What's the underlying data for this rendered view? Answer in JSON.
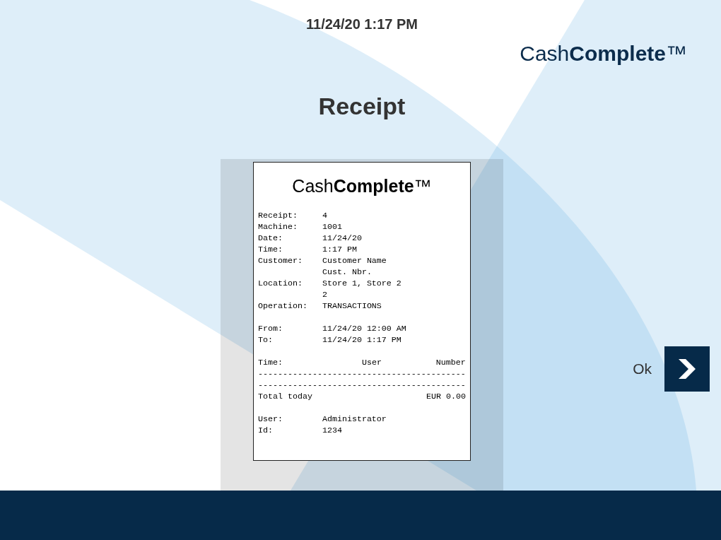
{
  "datetime": "11/24/20 1:17 PM",
  "brand_logo": "Cash**Complete**™",
  "title": "Receipt",
  "receipt": {
    "logo": "Cash**Complete**™",
    "details": [
      {
        "label": "Receipt:",
        "values": [
          "4"
        ]
      },
      {
        "label": "Machine:",
        "values": [
          "1001"
        ]
      },
      {
        "label": "Date:",
        "values": [
          "11/24/20"
        ]
      },
      {
        "label": "Time:",
        "values": [
          "1:17 PM"
        ]
      },
      {
        "label": "Customer:",
        "values": [
          "Customer Name",
          "Cust. Nbr."
        ]
      },
      {
        "label": "Location:",
        "values": [
          "Store 1, Store 2",
          "2"
        ]
      },
      {
        "label": "Operation:",
        "values": [
          "TRANSACTIONS"
        ]
      }
    ],
    "period": [
      {
        "label": "From:",
        "values": [
          "11/24/20 12:00 AM"
        ]
      },
      {
        "label": "To:",
        "values": [
          "11/24/20 1:17 PM"
        ]
      }
    ],
    "table": {
      "columns": [
        "Time:",
        "User",
        "Number"
      ],
      "separators": [
        "------------------------------------------",
        "------------------------------------------"
      ]
    },
    "total": {
      "label": "Total today",
      "value": "EUR 0.00"
    },
    "operator": [
      {
        "label": "User:",
        "values": [
          "Administrator"
        ]
      },
      {
        "label": "Id:",
        "values": [
          "1234"
        ]
      }
    ]
  },
  "ok_button": {
    "label": "Ok"
  }
}
